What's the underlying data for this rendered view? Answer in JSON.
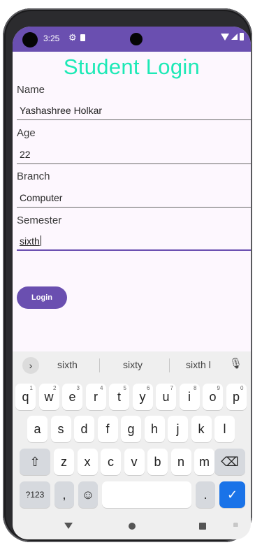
{
  "status_bar": {
    "time": "3:25"
  },
  "app": {
    "title": "Student Login",
    "fields": [
      {
        "label": "Name",
        "value": "Yashashree Holkar"
      },
      {
        "label": "Age",
        "value": "22"
      },
      {
        "label": "Branch",
        "value": "Computer"
      },
      {
        "label": "Semester",
        "value": "sixth"
      }
    ],
    "login_label": "Login"
  },
  "keyboard": {
    "suggestions": [
      "sixth",
      "sixty",
      "sixth l"
    ],
    "row1": [
      "q",
      "w",
      "e",
      "r",
      "t",
      "y",
      "u",
      "i",
      "o",
      "p"
    ],
    "row1_hints": [
      "1",
      "2",
      "3",
      "4",
      "5",
      "6",
      "7",
      "8",
      "9",
      "0"
    ],
    "row2": [
      "a",
      "s",
      "d",
      "f",
      "g",
      "h",
      "j",
      "k",
      "l"
    ],
    "row3": [
      "z",
      "x",
      "c",
      "v",
      "b",
      "n",
      "m"
    ],
    "symbols_label": "?123",
    "comma_label": ",",
    "period_label": "."
  },
  "colors": {
    "accent": "#6a4fb0",
    "title": "#1de9b6",
    "enter": "#1a73e8"
  }
}
